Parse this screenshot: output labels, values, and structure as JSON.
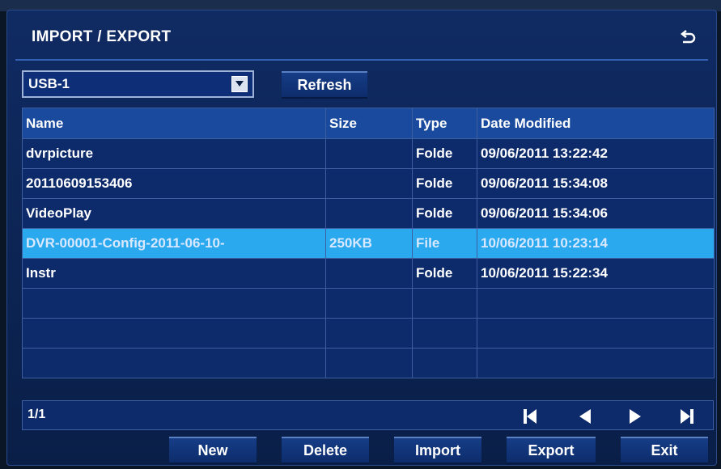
{
  "window": {
    "title": "IMPORT / EXPORT"
  },
  "device": {
    "selected": "USB-1"
  },
  "buttons": {
    "refresh": "Refresh",
    "new": "New",
    "delete": "Delete",
    "import": "Import",
    "export": "Export",
    "exit": "Exit"
  },
  "table": {
    "headers": [
      "Name",
      "Size",
      "Type",
      "Date Modified"
    ],
    "rows": [
      {
        "name": "dvrpicture",
        "size": "",
        "type": "Folde",
        "date": "09/06/2011 13:22:42"
      },
      {
        "name": "20110609153406",
        "size": "",
        "type": "Folde",
        "date": "09/06/2011 15:34:08"
      },
      {
        "name": "VideoPlay",
        "size": "",
        "type": "Folde",
        "date": "09/06/2011 15:34:06"
      },
      {
        "name": "DVR-00001-Config-2011-06-10-",
        "size": "250KB",
        "type": "File",
        "date": "10/06/2011 10:23:14"
      },
      {
        "name": "Instr",
        "size": "",
        "type": "Folde",
        "date": "10/06/2011 15:22:34"
      },
      {
        "name": "",
        "size": "",
        "type": "",
        "date": ""
      },
      {
        "name": "",
        "size": "",
        "type": "",
        "date": ""
      },
      {
        "name": "",
        "size": "",
        "type": "",
        "date": ""
      }
    ]
  },
  "pagination": {
    "label": "1/1"
  },
  "icons": {
    "back": "back-arrow-icon",
    "dropdown": "dropdown-arrow-icon",
    "first": "first-page-icon",
    "prev": "prev-page-icon",
    "next": "next-page-icon",
    "last": "last-page-icon"
  },
  "colors": {
    "selected_row": "#2aa9ee",
    "header_row": "#1a4a9d",
    "body_row": "#0d2b6a"
  }
}
